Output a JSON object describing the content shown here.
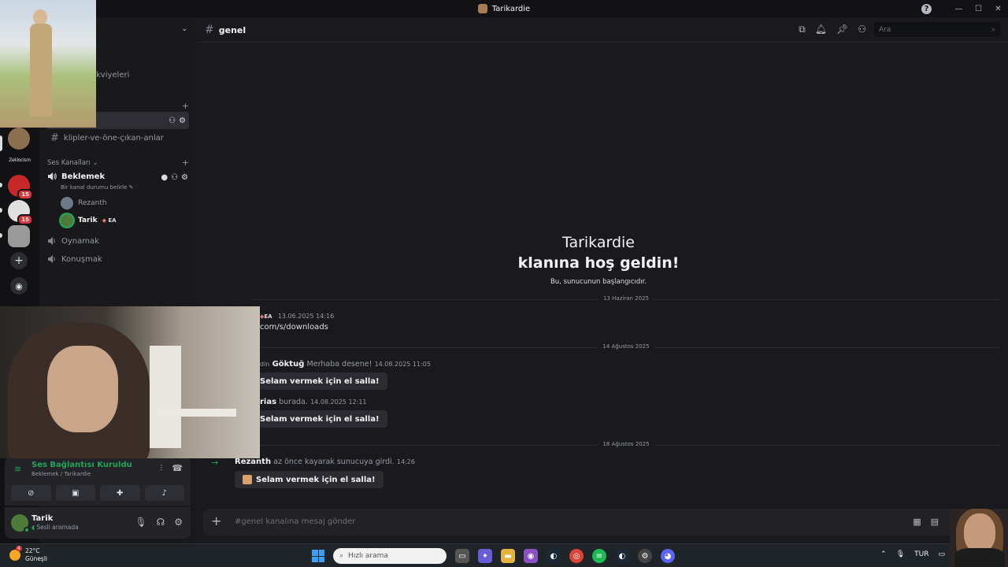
{
  "window": {
    "title": "Tarikardie"
  },
  "servers": [
    {
      "name": "server-1",
      "badge": ""
    },
    {
      "name": "server-text",
      "label": "Zeklocism"
    },
    {
      "name": "server-3",
      "badge": "15"
    },
    {
      "name": "server-4",
      "badge": "15"
    },
    {
      "name": "server-5",
      "badge": ""
    }
  ],
  "sidebar": {
    "boosts": "kviyeleri",
    "text_channel": "klipler-ve-öne-çıkan-anlar",
    "voice_category": "Ses Kanalları",
    "voice_channels": [
      {
        "name": "Beklemek",
        "status": "Bir kanal durumu belirle"
      },
      {
        "name": "Oynamak"
      },
      {
        "name": "Konuşmak"
      }
    ],
    "voice_users": [
      {
        "name": "Rezanth"
      },
      {
        "name": "Tarik",
        "tag": "EA"
      }
    ]
  },
  "voice_panel": {
    "title": "Ses Bağlantısı Kuruldu",
    "subtitle": "Beklemek / Tarikardie"
  },
  "user_panel": {
    "name": "Tarik",
    "status": "Sesli aramada"
  },
  "channel": {
    "name": "genel",
    "search_placeholder": "Ara",
    "composer_placeholder": "#genel kanalına mesaj gönder"
  },
  "welcome": {
    "line1": "Tarikardie",
    "line2": "klanına hoş geldin!",
    "line3": "Bu, sunucunun başlangıcıdır."
  },
  "messages": {
    "d1": "13 Haziran 2025",
    "m1_tag": "EA",
    "m1_time": "13.06.2025 14:16",
    "m1_text": "com/s/downloads",
    "d2": "14 Ağustos 2025",
    "m2_prefix": "din",
    "m2_user": "Göktuğ",
    "m2_text": "Merhaba desene!",
    "m2_time": "14.08.2025 11:05",
    "wave": "Selam vermek için el salla!",
    "m3_user": "rias",
    "m3_text": "burada.",
    "m3_time": "14.08.2025 12:11",
    "d3": "18 Ağustos 2025",
    "m4_user": "Rezanth",
    "m4_text": "az önce kayarak sunucuya girdi.",
    "m4_time": "14:26"
  },
  "taskbar": {
    "temp": "22°C",
    "weather": "Güneşli",
    "weather_badge": "4",
    "search": "Hızlı arama",
    "lang": "TUR"
  },
  "colors": {
    "accent_green": "#23a55a",
    "badge_red": "#da373c"
  }
}
